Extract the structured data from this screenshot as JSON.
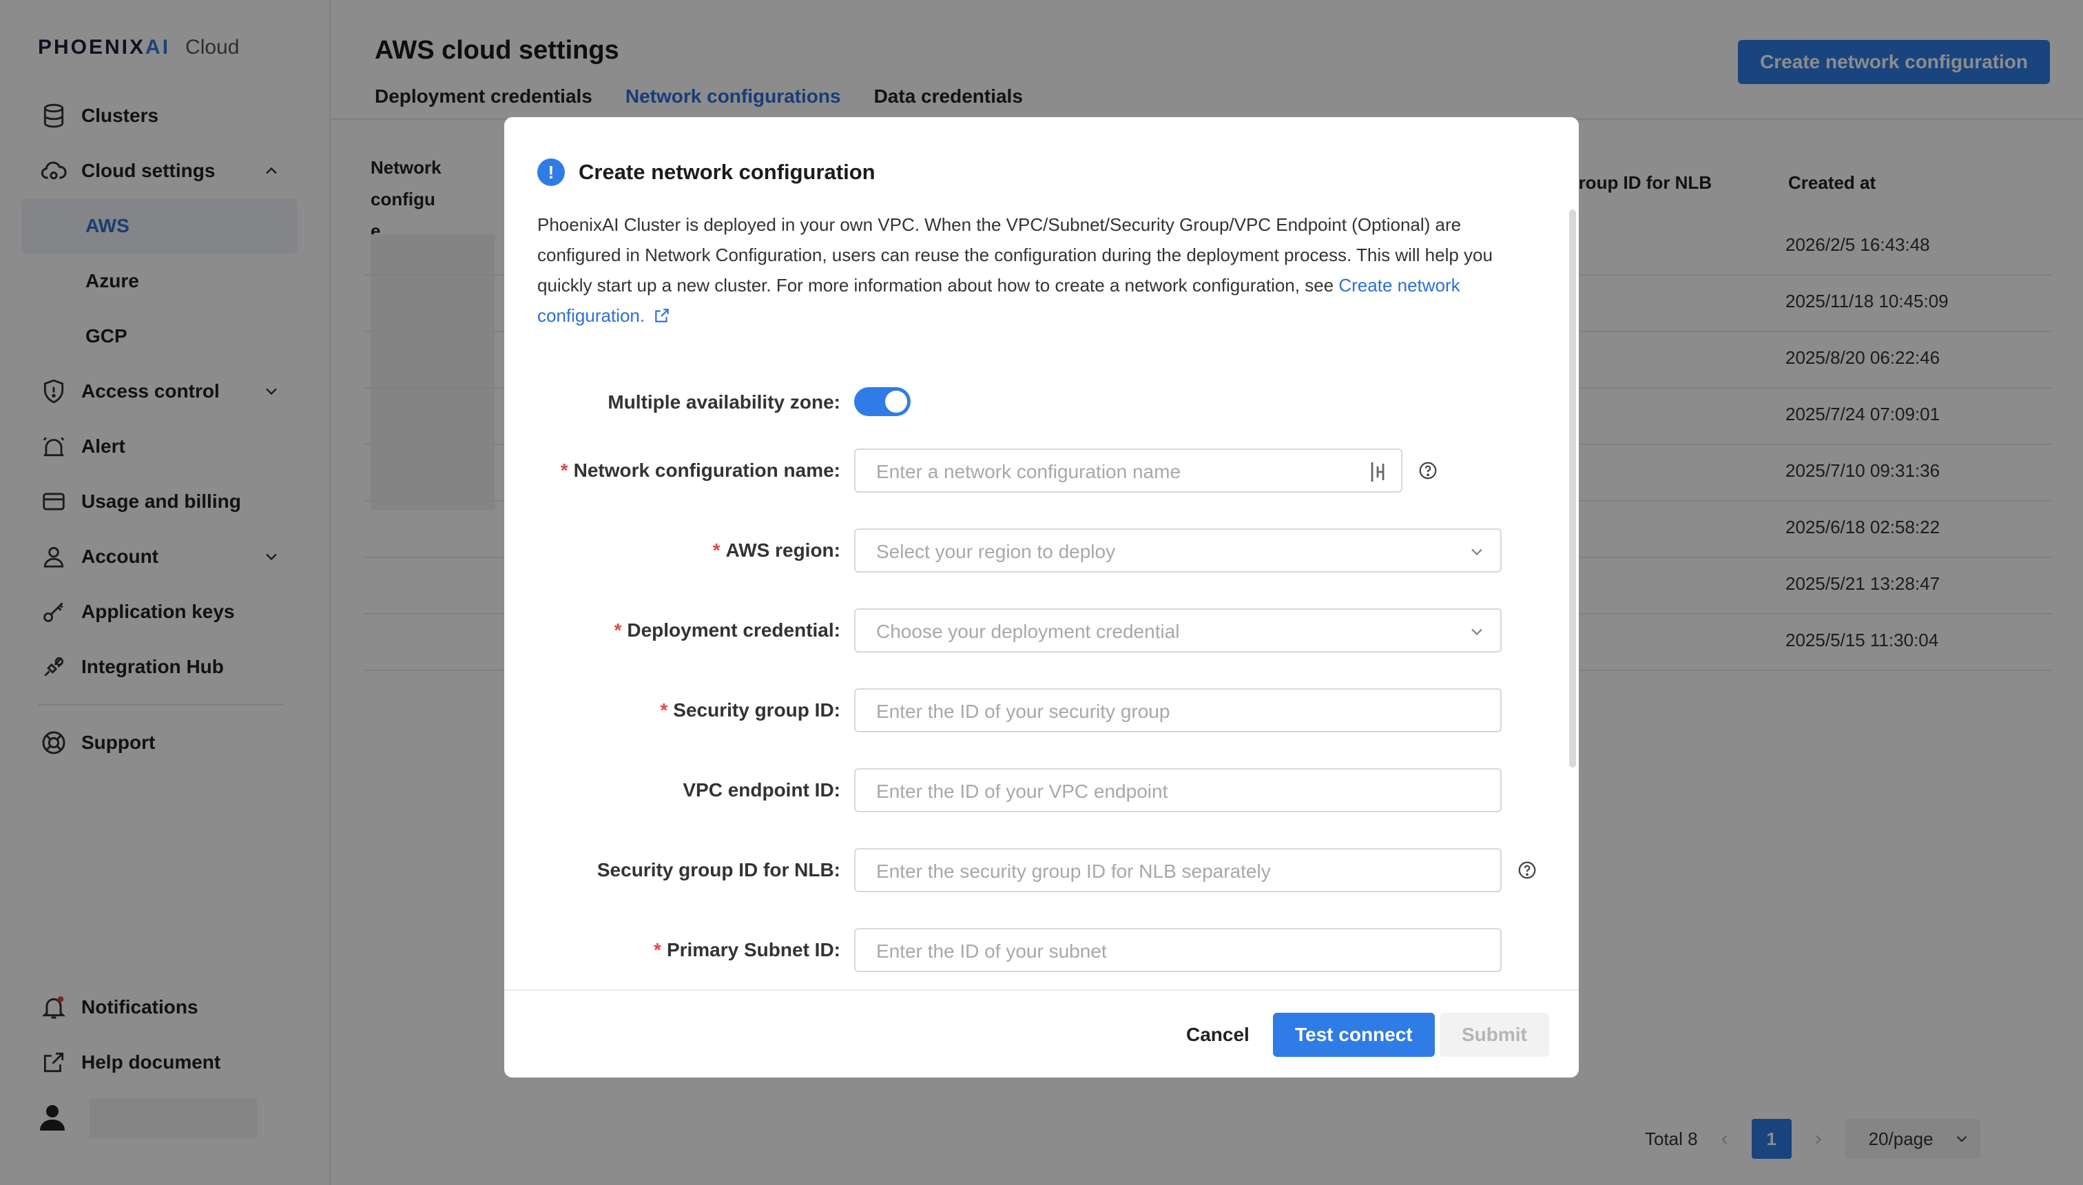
{
  "brand": {
    "name_prefix": "PHOENIX",
    "name_suffix": "AI",
    "product": "Cloud"
  },
  "sidebar": {
    "items": [
      {
        "label": "Clusters",
        "icon": "database-icon"
      },
      {
        "label": "Cloud settings",
        "icon": "cloud-settings-icon",
        "expanded": true
      },
      {
        "label": "Access control",
        "icon": "shield-icon"
      },
      {
        "label": "Alert",
        "icon": "alarm-icon"
      },
      {
        "label": "Usage and billing",
        "icon": "card-icon"
      },
      {
        "label": "Account",
        "icon": "user-icon"
      },
      {
        "label": "Application keys",
        "icon": "key-icon"
      },
      {
        "label": "Integration Hub",
        "icon": "plug-icon"
      },
      {
        "label": "Support",
        "icon": "lifebuoy-icon"
      }
    ],
    "cloud_sub": [
      "AWS",
      "Azure",
      "GCP"
    ],
    "active_sub": "AWS",
    "bottom": [
      {
        "label": "Notifications",
        "icon": "bell-icon"
      },
      {
        "label": "Help document",
        "icon": "external-link-icon"
      }
    ]
  },
  "page": {
    "title": "AWS cloud settings",
    "tabs": [
      "Deployment credentials",
      "Network configurations",
      "Data credentials"
    ],
    "active_tab": "Network configurations",
    "create_button": "Create network configuration"
  },
  "table": {
    "col_name_line1": "Network configu",
    "col_name_line2": "e",
    "col_nlb": "rity group ID for NLB",
    "col_created": "Created at",
    "rows": [
      "2026/2/5 16:43:48",
      "2025/11/18 10:45:09",
      "2025/8/20 06:22:46",
      "2025/7/24 07:09:01",
      "2025/7/10 09:31:36",
      "2025/6/18 02:58:22",
      "2025/5/21 13:28:47",
      "2025/5/15 11:30:04"
    ]
  },
  "pagination": {
    "total": "Total 8",
    "page": "1",
    "page_size": "20/page"
  },
  "modal": {
    "title": "Create network configuration",
    "description": "PhoenixAI Cluster is deployed in your own VPC. When the VPC/Subnet/Security Group/VPC Endpoint (Optional) are configured in Network Configuration, users can reuse the configuration during the deployment process. This will help you quickly start up a new cluster. For more information about how to create a network configuration, see ",
    "link_text": "Create network configuration.",
    "fields": {
      "multi_az": {
        "label": "Multiple availability zone:",
        "on": true
      },
      "name": {
        "label": "Network configuration name:",
        "placeholder": "Enter a network configuration name",
        "required": true
      },
      "region": {
        "label": "AWS region:",
        "placeholder": "Select your region to deploy",
        "required": true
      },
      "credential": {
        "label": "Deployment credential:",
        "placeholder": "Choose your deployment credential",
        "required": true
      },
      "sg": {
        "label": "Security group ID:",
        "placeholder": "Enter the ID of your security group",
        "required": true
      },
      "vpce": {
        "label": "VPC endpoint ID:",
        "placeholder": "Enter the ID of your VPC endpoint",
        "required": false
      },
      "sg_nlb": {
        "label": "Security group ID for NLB:",
        "placeholder": "Enter the security group ID for NLB separately",
        "required": false
      },
      "subnet": {
        "label": "Primary Subnet ID:",
        "placeholder": "Enter the ID of your subnet",
        "required": true
      }
    },
    "buttons": {
      "cancel": "Cancel",
      "test": "Test connect",
      "submit": "Submit"
    }
  },
  "colors": {
    "accent": "#2f7ce6",
    "required": "#e04848",
    "overlay": "rgba(0,0,0,0.45)"
  }
}
